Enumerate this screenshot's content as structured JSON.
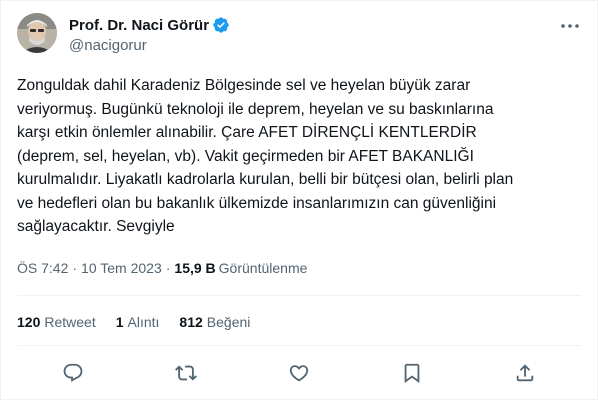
{
  "author": {
    "display_name": "Prof. Dr. Naci Görür",
    "handle": "@nacigorur"
  },
  "tweet": {
    "text": "Zonguldak dahil Karadeniz Bölgesinde sel ve heyelan büyük zarar\nveriyormuş. Bugünkü teknoloji ile deprem, heyelan ve su baskınlarına\nkarşı etkin önlemler alınabilir. Çare AFET DİRENÇLİ KENTLERDİR\n(deprem, sel, heyelan, vb). Vakit geçirmeden bir AFET BAKANLIĞI\nkurulmalıdır. Liyakatlı kadrolarla kurulan, belli bir bütçesi olan, belirli plan\nve hedefleri olan bu bakanlık ülkemizde insanlarımızın can güvenliğini\nsağlayacaktır. Sevgiyle",
    "time": "ÖS 7:42",
    "date": "10 Tem 2023",
    "views_count": "15,9 B",
    "views_label": "Görüntülenme"
  },
  "stats": {
    "retweets_count": "120",
    "retweets_label": "Retweet",
    "quotes_count": "1",
    "quotes_label": "Alıntı",
    "likes_count": "812",
    "likes_label": "Beğeni"
  },
  "icons": {
    "verified": "verified-badge-icon",
    "more": "more-dots-icon",
    "reply": "reply-icon",
    "retweet": "retweet-icon",
    "like": "heart-icon",
    "bookmark": "bookmark-icon",
    "share": "share-icon"
  },
  "colors": {
    "verified_blue": "#1d9bf0",
    "text": "#0f1419",
    "secondary": "#536471",
    "divider": "#eff3f4"
  }
}
